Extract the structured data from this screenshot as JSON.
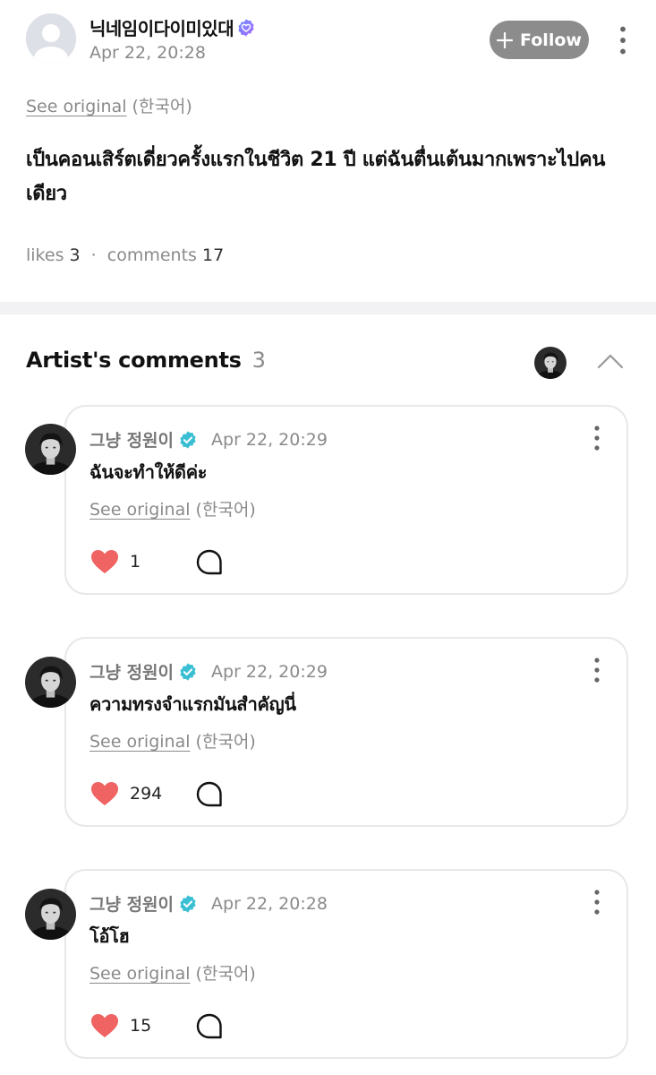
{
  "post": {
    "author": "닉네임이다이미있대",
    "badge_icon": "fan-badge-icon",
    "timestamp": "Apr 22, 20:28",
    "follow_label": "Follow",
    "see_original": "See original",
    "language": "(한국어)",
    "text": "เป็นคอนเสิร์ตเดี่ยวครั้งแรกในชีวิต 21 ปี แต่ฉันตื่นเต้นมากเพราะไปคนเดียว",
    "likes_label": "likes",
    "likes_count": "3",
    "separator": "·",
    "comments_label": "comments",
    "comments_count": "17"
  },
  "artist_comments": {
    "title": "Artist's comments",
    "count": "3",
    "items": [
      {
        "author": "그냥 정원이",
        "timestamp": "Apr 22, 20:29",
        "text": "ฉันจะทำให้ดีค่ะ",
        "see_original": "See original",
        "language": "(한국어)",
        "likes": "1"
      },
      {
        "author": "그냥 정원이",
        "timestamp": "Apr 22, 20:29",
        "text": "ความทรงจำแรกมันสำคัญนี่",
        "see_original": "See original",
        "language": "(한국어)",
        "likes": "294"
      },
      {
        "author": "그냥 정원이",
        "timestamp": "Apr 22, 20:28",
        "text": "โอ้โฮ",
        "see_original": "See original",
        "language": "(한국어)",
        "likes": "15"
      }
    ]
  },
  "colors": {
    "heart": "#f06363",
    "verified": "#3bbfd4",
    "follow_bg": "#8c8c8c",
    "muted_text": "#8a8a8a"
  }
}
